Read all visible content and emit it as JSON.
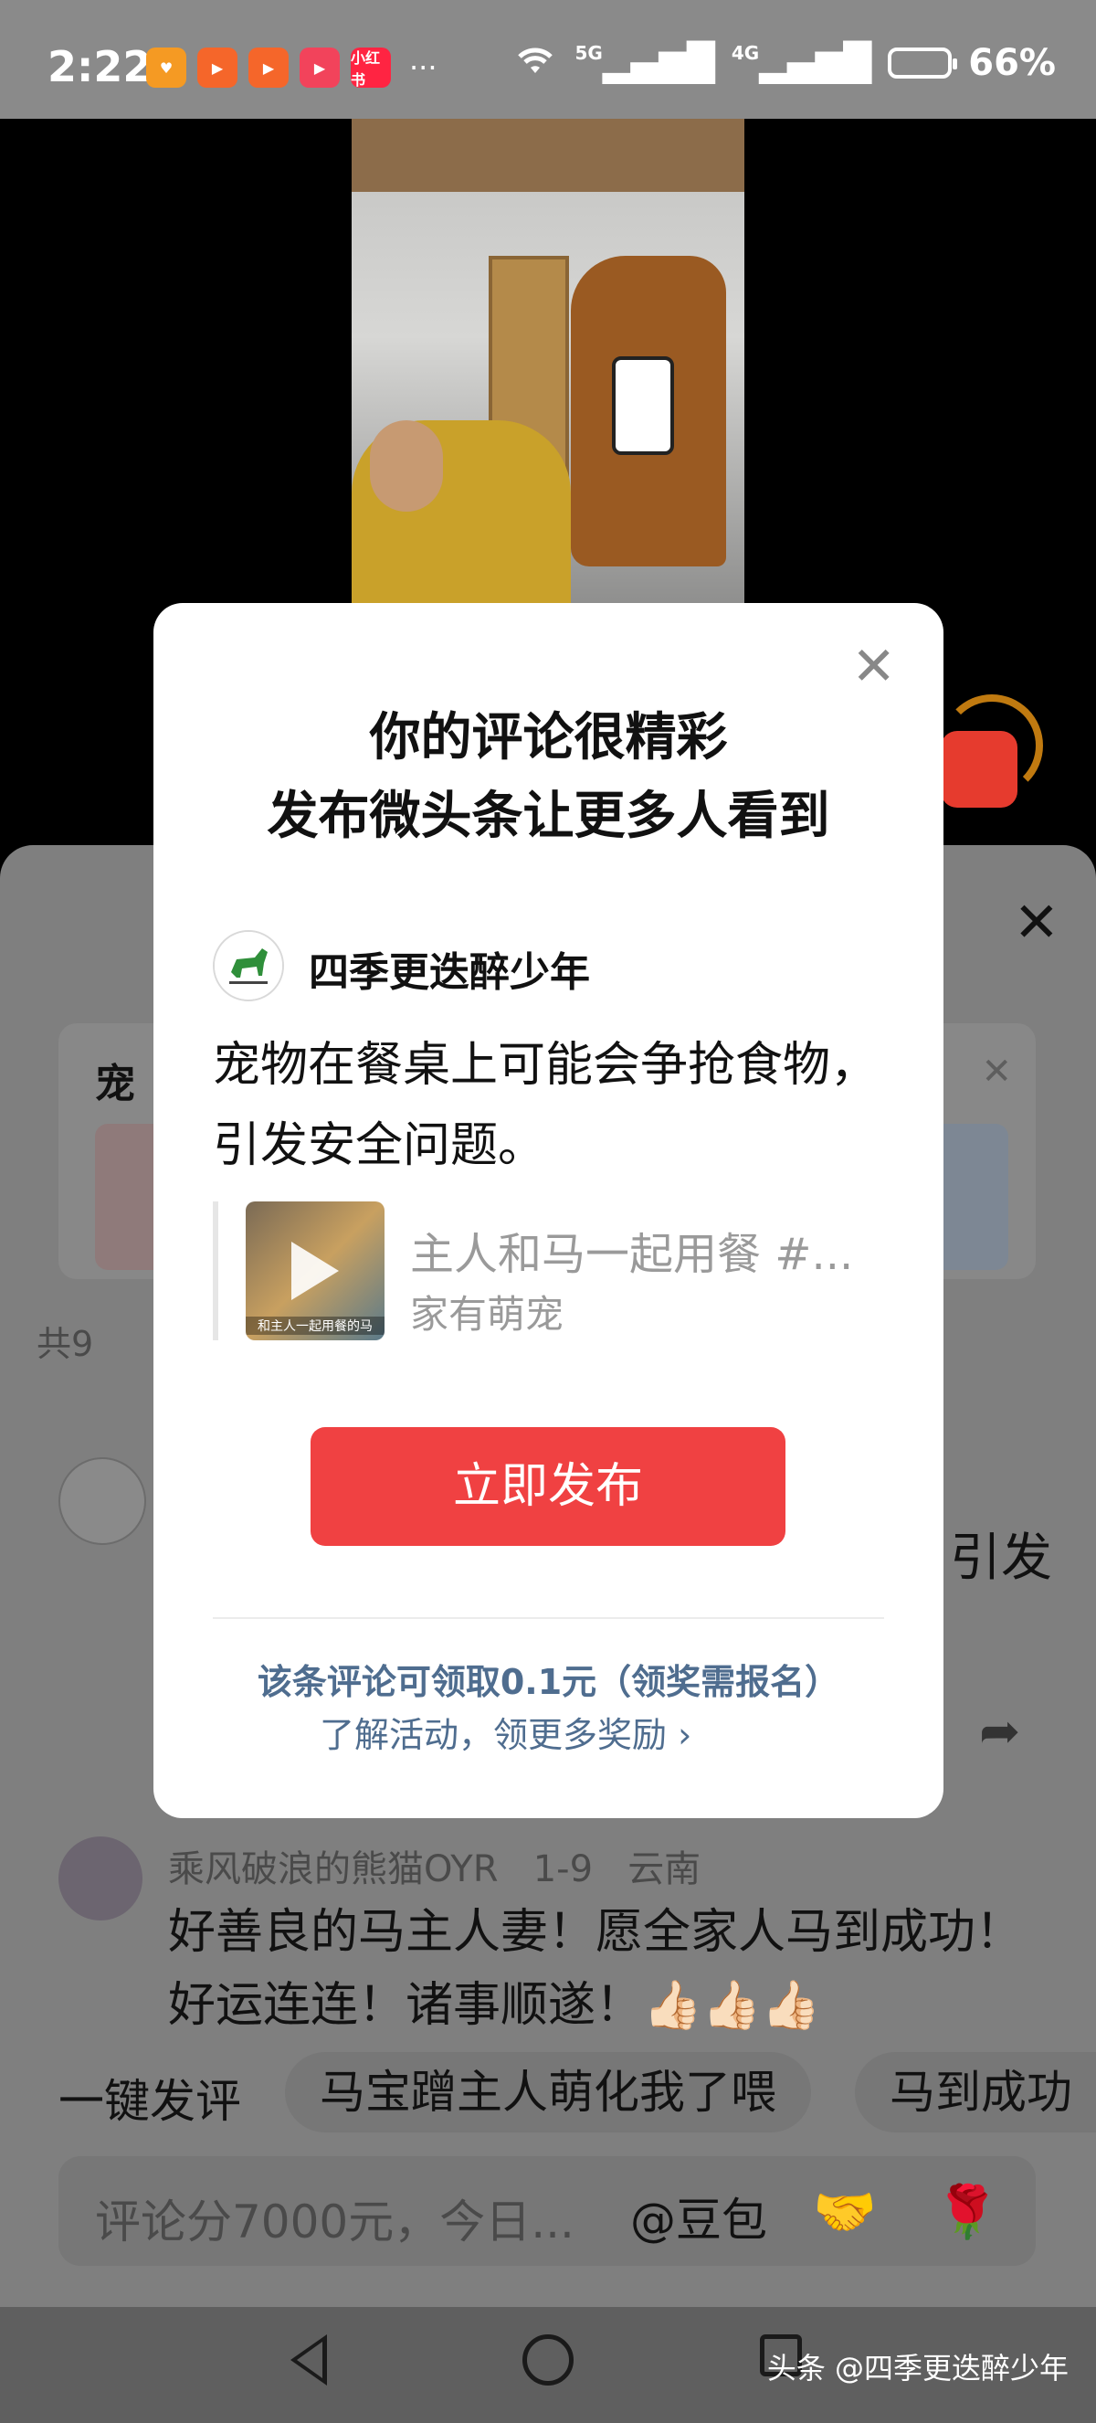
{
  "status_bar": {
    "time": "2:22",
    "apps": [
      {
        "icon": "heart-app-icon",
        "color": "#f59a23"
      },
      {
        "icon": "kuaishou-app-icon",
        "color": "#f5662a"
      },
      {
        "icon": "kuaishou-lite-app-icon",
        "color": "#f5662a"
      },
      {
        "icon": "video-app-icon",
        "color": "#f2435b"
      },
      {
        "icon": "xiaohongshu-app-icon",
        "color": "#ff2442",
        "label": "小红书"
      }
    ],
    "more": "···",
    "network_5g": "5G",
    "network_4g": "4G",
    "battery": "66%"
  },
  "comment_sheet": {
    "close_icon": "✕",
    "topic_title": "宠",
    "topic_count": "共9",
    "comment1_trailing": "引发",
    "comment2": {
      "user": "乘风破浪的熊猫OYR",
      "date": "1-9",
      "location": "云南",
      "text": "好善良的马主人妻！愿全家人马到成功！好运连连！诸事顺遂！👍🏻👍🏻👍🏻"
    },
    "quick_reply": {
      "label": "一键发评",
      "chips": [
        "马宝蹭主人萌化我了喂",
        "马到成功"
      ]
    },
    "input": {
      "placeholder": "评论分7000元，今日...",
      "at_label": "@豆包",
      "emoji1": "🤝",
      "emoji2": "🌹"
    }
  },
  "modal": {
    "title_line1": "你的评论很精彩",
    "title_line2": "发布微头条让更多人看到",
    "author": "四季更迭醉少年",
    "comment": "宠物在餐桌上可能会争抢食物，引发安全问题。",
    "quoted_video": {
      "title": "主人和马一起用餐 #...",
      "source": "家有萌宠",
      "caption": "和主人一起用餐的马"
    },
    "publish_button": "立即发布",
    "reward_text": "该条评论可领取0.1元（领奖需报名）",
    "reward_link": "了解活动，领更多奖励 ›"
  },
  "watermark": "头条 @四季更迭醉少年"
}
